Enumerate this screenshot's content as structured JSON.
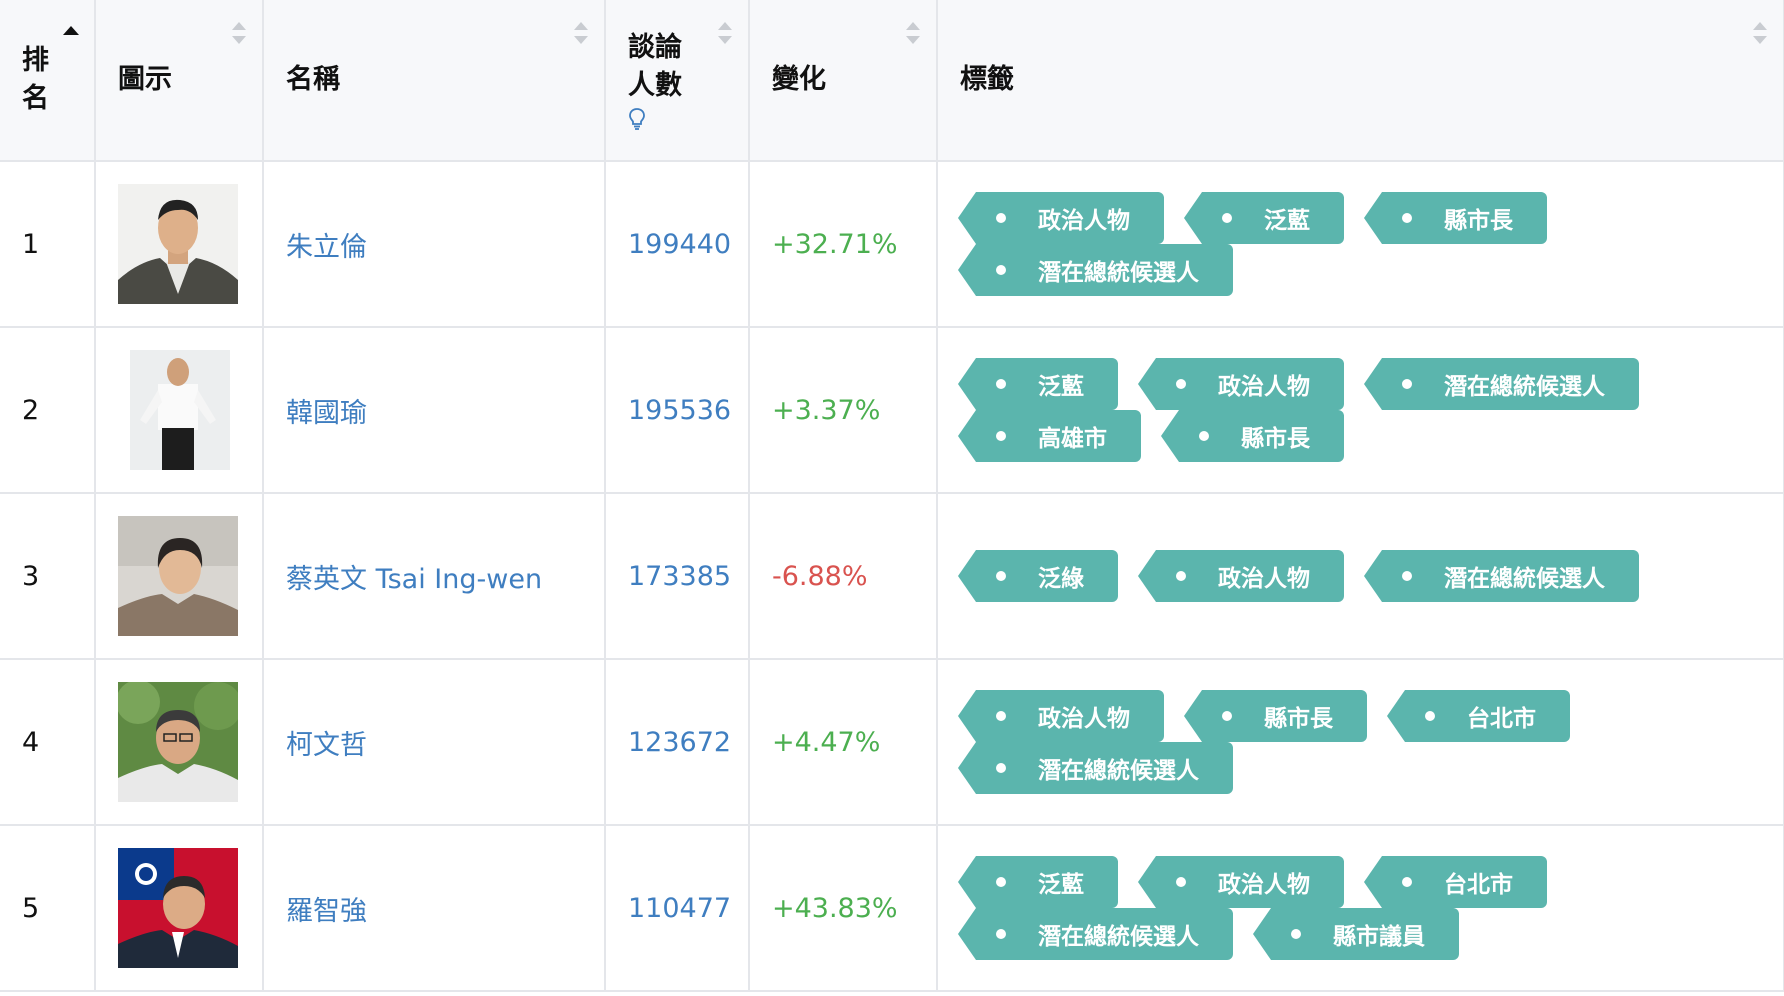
{
  "headers": {
    "rank": "排名",
    "icon": "圖示",
    "name": "名稱",
    "count": "談論人數",
    "change": "變化",
    "tags": "標籤"
  },
  "rows": [
    {
      "rank": "1",
      "name": "朱立倫",
      "count": "199440",
      "change": "+32.71%",
      "change_dir": "up",
      "tags": [
        "政治人物",
        "泛藍",
        "縣市長",
        "潛在總統候選人"
      ]
    },
    {
      "rank": "2",
      "name": "韓國瑜",
      "count": "195536",
      "change": "+3.37%",
      "change_dir": "up",
      "tags": [
        "泛藍",
        "政治人物",
        "潛在總統候選人",
        "高雄市",
        "縣市長"
      ]
    },
    {
      "rank": "3",
      "name": "蔡英文 Tsai Ing-wen",
      "count": "173385",
      "change": "-6.88%",
      "change_dir": "down",
      "tags": [
        "泛綠",
        "政治人物",
        "潛在總統候選人"
      ]
    },
    {
      "rank": "4",
      "name": "柯文哲",
      "count": "123672",
      "change": "+4.47%",
      "change_dir": "up",
      "tags": [
        "政治人物",
        "縣市長",
        "台北市",
        "潛在總統候選人"
      ]
    },
    {
      "rank": "5",
      "name": "羅智強",
      "count": "110477",
      "change": "+43.83%",
      "change_dir": "up",
      "tags": [
        "泛藍",
        "政治人物",
        "台北市",
        "潛在總統候選人",
        "縣市議員"
      ]
    }
  ],
  "colors": {
    "tag_bg": "#5bb5ad",
    "link": "#3f7ec0",
    "positive": "#4caf50",
    "negative": "#d9534f",
    "header_bg": "#f7f8fa"
  },
  "icons": [
    "sort-up-icon",
    "sort-both-icon",
    "lightbulb-icon",
    "tag-dot-icon"
  ]
}
